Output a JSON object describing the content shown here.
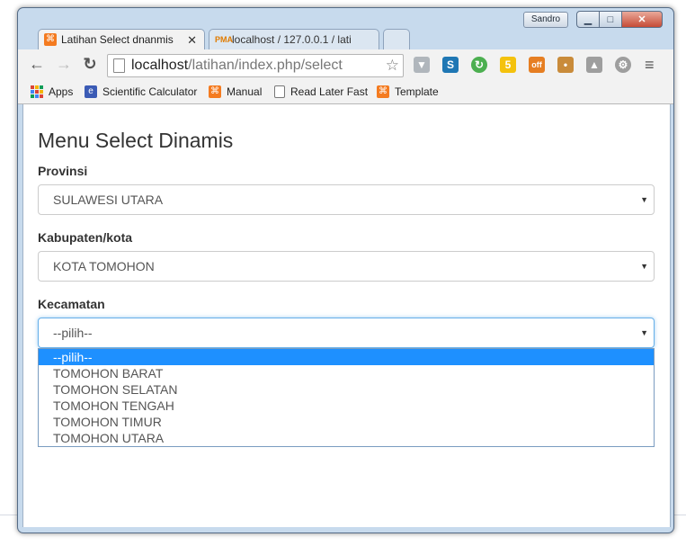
{
  "window": {
    "profile_name": "Sandro",
    "controls": {
      "minimize": "▁",
      "maximize": "□",
      "close": "✕"
    }
  },
  "tabs": [
    {
      "title": "Latihan Select dnanmis",
      "active": true,
      "icon": "xampp-icon"
    },
    {
      "title": "localhost / 127.0.0.1 / lati",
      "active": false,
      "icon": "phpmyadmin-icon",
      "icon_text": "PMA"
    }
  ],
  "toolbar": {
    "url_host": "localhost",
    "url_path": "/latihan/index.php/select"
  },
  "bookmarks": [
    {
      "label": "Apps",
      "icon": "apps-grid-icon"
    },
    {
      "label": "Scientific Calculator",
      "icon": "calculator-icon"
    },
    {
      "label": "Manual",
      "icon": "xampp-icon"
    },
    {
      "label": "Read Later Fast",
      "icon": "page-icon"
    },
    {
      "label": "Template",
      "icon": "xampp-icon"
    }
  ],
  "extensions": [
    {
      "name": "shield-icon",
      "color": "#9aa0a6"
    },
    {
      "name": "s-extension-icon",
      "color": "#1f77b4",
      "text": "S"
    },
    {
      "name": "refresh-green-icon",
      "color": "#4caf50"
    },
    {
      "name": "bulb-icon",
      "color": "#f4c20d",
      "badge": "5"
    },
    {
      "name": "robot-icon",
      "color": "#e67e22",
      "badge": "off"
    },
    {
      "name": "face-icon",
      "color": "#c98b3a"
    },
    {
      "name": "drive-icon",
      "color": "#9e9e9e"
    },
    {
      "name": "gear-ext-icon",
      "color": "#9e9e9e"
    }
  ],
  "main": {
    "title": "Menu Select Dinamis",
    "fields": [
      {
        "label": "Provinsi",
        "value": "SULAWESI UTARA"
      },
      {
        "label": "Kabupaten/kota",
        "value": "KOTA TOMOHON"
      },
      {
        "label": "Kecamatan",
        "value": "--pilih--"
      }
    ],
    "kecamatan_options": [
      "--pilih--",
      "TOMOHON BARAT",
      "TOMOHON SELATAN",
      "TOMOHON TENGAH",
      "TOMOHON TIMUR",
      "TOMOHON UTARA"
    ]
  },
  "colors": {
    "option_highlight": "#1e90ff",
    "focus_border": "#66afe9"
  }
}
